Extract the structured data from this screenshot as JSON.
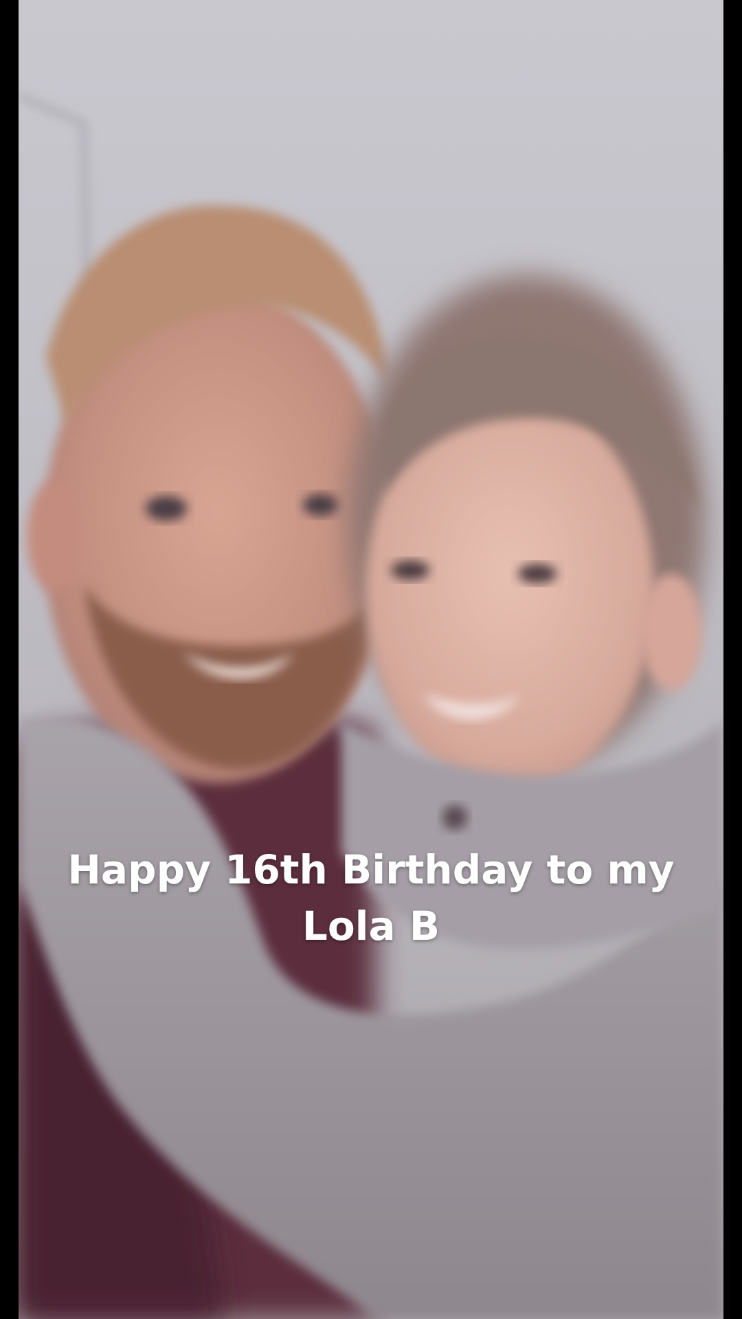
{
  "caption": {
    "line1": "Happy 16th Birthday to my",
    "line2": "Lola B"
  },
  "colors": {
    "letterbox": "#000000",
    "caption_text": "#ffffff"
  }
}
